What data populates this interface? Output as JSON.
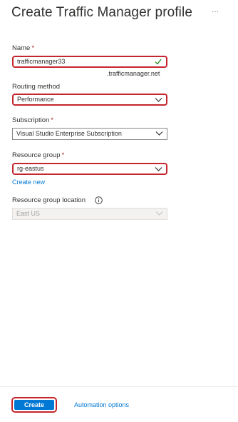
{
  "header": {
    "title": "Create Traffic Manager profile",
    "more_label": "···"
  },
  "form": {
    "name": {
      "label": "Name",
      "required_mark": "*",
      "value": "trafficmanager33",
      "suffix": ".trafficmanager.net",
      "valid_icon": "checkmark-icon"
    },
    "routing_method": {
      "label": "Routing method",
      "value": "Performance"
    },
    "subscription": {
      "label": "Subscription",
      "required_mark": "*",
      "value": "Visual Studio Enterprise Subscription"
    },
    "resource_group": {
      "label": "Resource group",
      "required_mark": "*",
      "value": "rg-eastus",
      "create_new_link": "Create new"
    },
    "resource_group_location": {
      "label": "Resource group location",
      "value": "East US",
      "info_icon": "info-icon"
    }
  },
  "footer": {
    "create_label": "Create",
    "automation_label": "Automation options"
  },
  "colors": {
    "accent": "#0078d4",
    "highlight": "#c4262e",
    "required": "#a4262c",
    "valid": "#107c10"
  }
}
